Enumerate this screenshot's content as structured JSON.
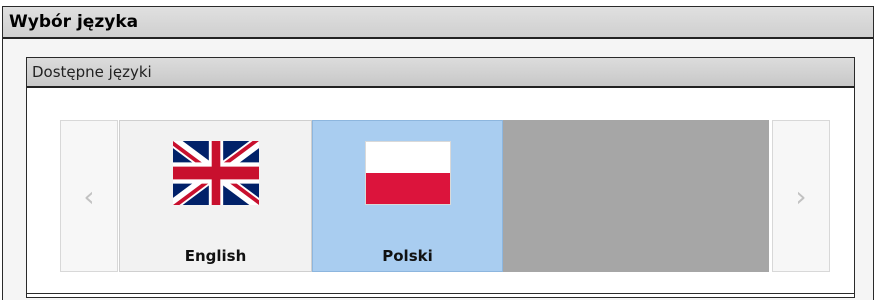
{
  "window": {
    "title": "Wybór języka"
  },
  "languages_panel": {
    "title": "Dostępne języki",
    "prev_symbol": "‹",
    "next_symbol": "›",
    "items": [
      {
        "label": "English",
        "flag": "uk-flag-icon",
        "selected": false
      },
      {
        "label": "Polski",
        "flag": "poland-flag-icon",
        "selected": true
      }
    ]
  },
  "colors": {
    "selected_tile": "#a9cdf0",
    "empty_slot": "#a6a6a6",
    "poland_red": "#dc143c",
    "uk_blue": "#012169",
    "uk_red": "#c8102e"
  }
}
